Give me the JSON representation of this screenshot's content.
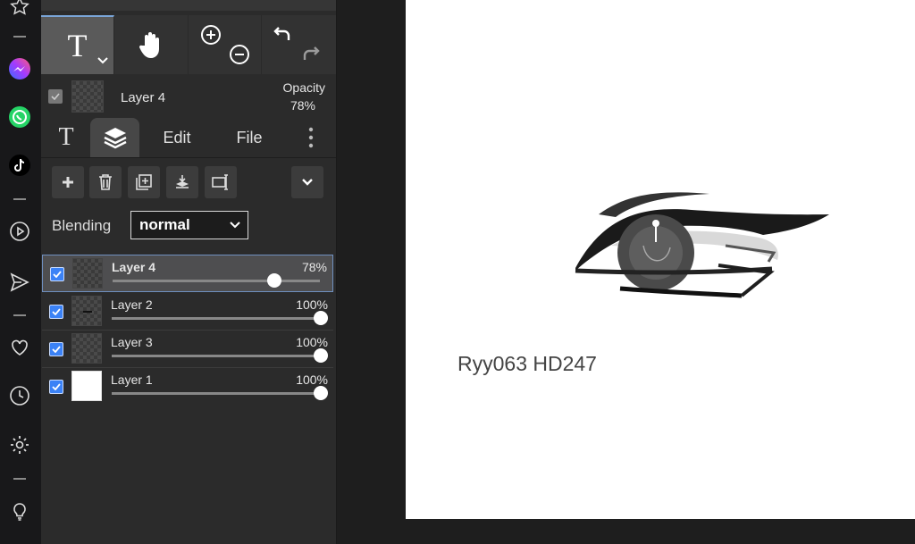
{
  "colors": {
    "accent": "#3b82f6",
    "panel": "#2b2b2b",
    "canvas": "#ffffff"
  },
  "rail": {
    "icons": [
      "star-icon",
      "messenger-icon",
      "whatsapp-icon",
      "tiktok-icon",
      "play-circle-icon",
      "send-icon",
      "heart-icon",
      "clock-icon",
      "gear-icon",
      "lightbulb-icon"
    ]
  },
  "toolbar": {
    "text_tool": "T",
    "tools": [
      "text-tool",
      "hand-tool",
      "zoom-in",
      "zoom-out",
      "undo",
      "redo"
    ]
  },
  "layer_info": {
    "name": "Layer 4",
    "opacity_label": "Opacity",
    "opacity_value": "78%"
  },
  "tabs": [
    {
      "label": "T"
    },
    {
      "label": "layers"
    },
    {
      "label": "Edit"
    },
    {
      "label": "File"
    }
  ],
  "blending": {
    "label": "Blending",
    "value": "normal"
  },
  "layers": [
    {
      "name": "Layer 4",
      "opacity": "78%",
      "opacity_value": 0.78,
      "visible": true,
      "selected": true
    },
    {
      "name": "Layer 2",
      "opacity": "100%",
      "opacity_value": 1.0,
      "visible": true,
      "selected": false
    },
    {
      "name": "Layer 3",
      "opacity": "100%",
      "opacity_value": 1.0,
      "visible": true,
      "selected": false
    },
    {
      "name": "Layer 1",
      "opacity": "100%",
      "opacity_value": 1.0,
      "visible": true,
      "selected": false
    }
  ],
  "canvas": {
    "watermark": "Ryy063 HD247"
  }
}
